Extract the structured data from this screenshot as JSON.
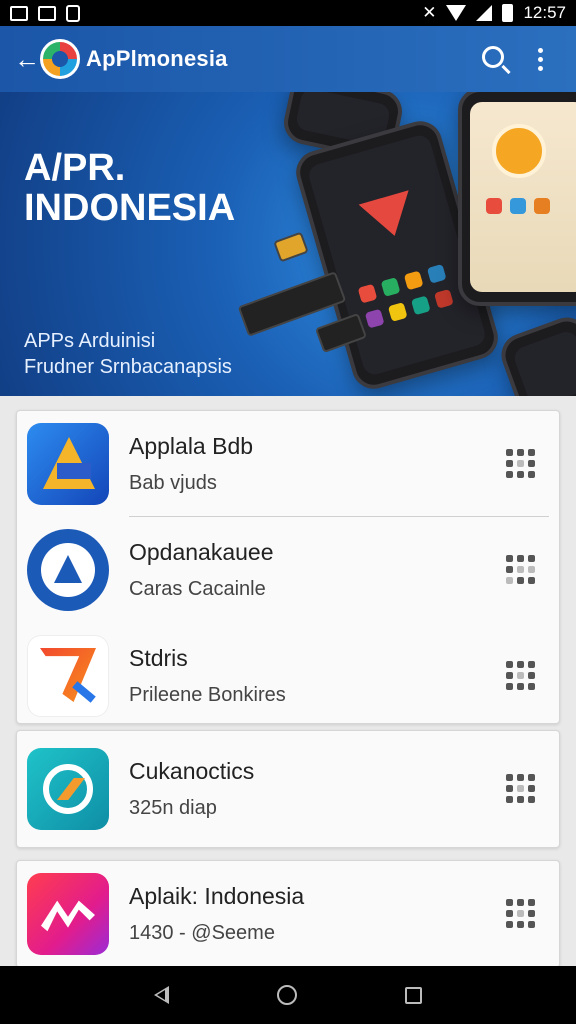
{
  "status_bar": {
    "time": "12:57",
    "left_icons": [
      "image-icon",
      "image-icon",
      "clipboard-icon"
    ],
    "right_icons": [
      "mute-icon",
      "wifi-icon",
      "signal-icon",
      "battery-icon"
    ]
  },
  "app_bar": {
    "title": "ApPlmonesia",
    "actions": [
      "search-icon",
      "more-vert-icon"
    ]
  },
  "banner": {
    "title_line1": "A/PR.",
    "title_line2": "INDONESIA",
    "subtitle_line1": "APPs Arduinisi",
    "subtitle_line2": "Frudner Srnbacanapsis"
  },
  "apps": [
    {
      "title": "Applala Bdb",
      "subtitle": "Bab vjuds",
      "icon": "blue-triangle-app-icon"
    },
    {
      "title": "Opdanakauee",
      "subtitle": "Caras Cacainle",
      "icon": "blue-circle-a-app-icon"
    },
    {
      "title": "Stdris",
      "subtitle": "Prileene Bonkires",
      "icon": "orange-arrow-app-icon"
    },
    {
      "title": "Cukanoctics",
      "subtitle": "325n diap",
      "icon": "teal-swirl-app-icon"
    },
    {
      "title": "Aplaik: Indonesia",
      "subtitle": "1430 - @Seeme",
      "icon": "pink-wave-app-icon"
    }
  ],
  "colors": {
    "app_bar": "#1b56a8",
    "banner": "#1a5fb4",
    "background": "#e9e9e9"
  }
}
